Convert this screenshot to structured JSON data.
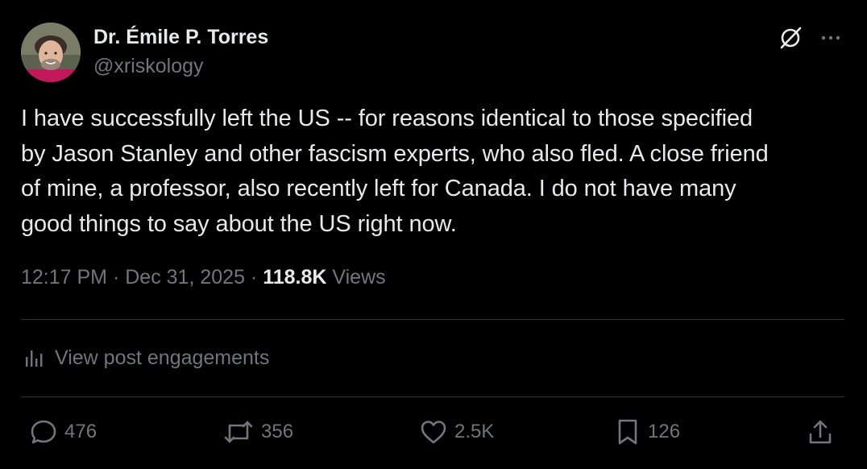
{
  "author": {
    "display_name": "Dr. Émile P. Torres",
    "handle": "@xriskology"
  },
  "header_icons": {
    "grok": "grok-icon",
    "more": "more-icon"
  },
  "post": {
    "text": "I have successfully left the US -- for reasons identical to those specified\nby Jason Stanley and other fascism experts, who also fled. A close friend\nof mine, a professor, also recently left for Canada. I do not have many\ngood things to say about the US right now."
  },
  "meta": {
    "time": "12:17 PM",
    "separator": "·",
    "date": "Dec 31, 2025",
    "views_count": "118.8K",
    "views_label": "Views"
  },
  "engagements": {
    "label": "View post engagements",
    "icon": "analytics-icon"
  },
  "actions": {
    "replies": "476",
    "reposts": "356",
    "likes": "2.5K",
    "bookmarks": "126"
  },
  "colors": {
    "background": "#000000",
    "text_primary": "#e7e9ea",
    "text_secondary": "#71767b",
    "divider": "#2f3336"
  }
}
